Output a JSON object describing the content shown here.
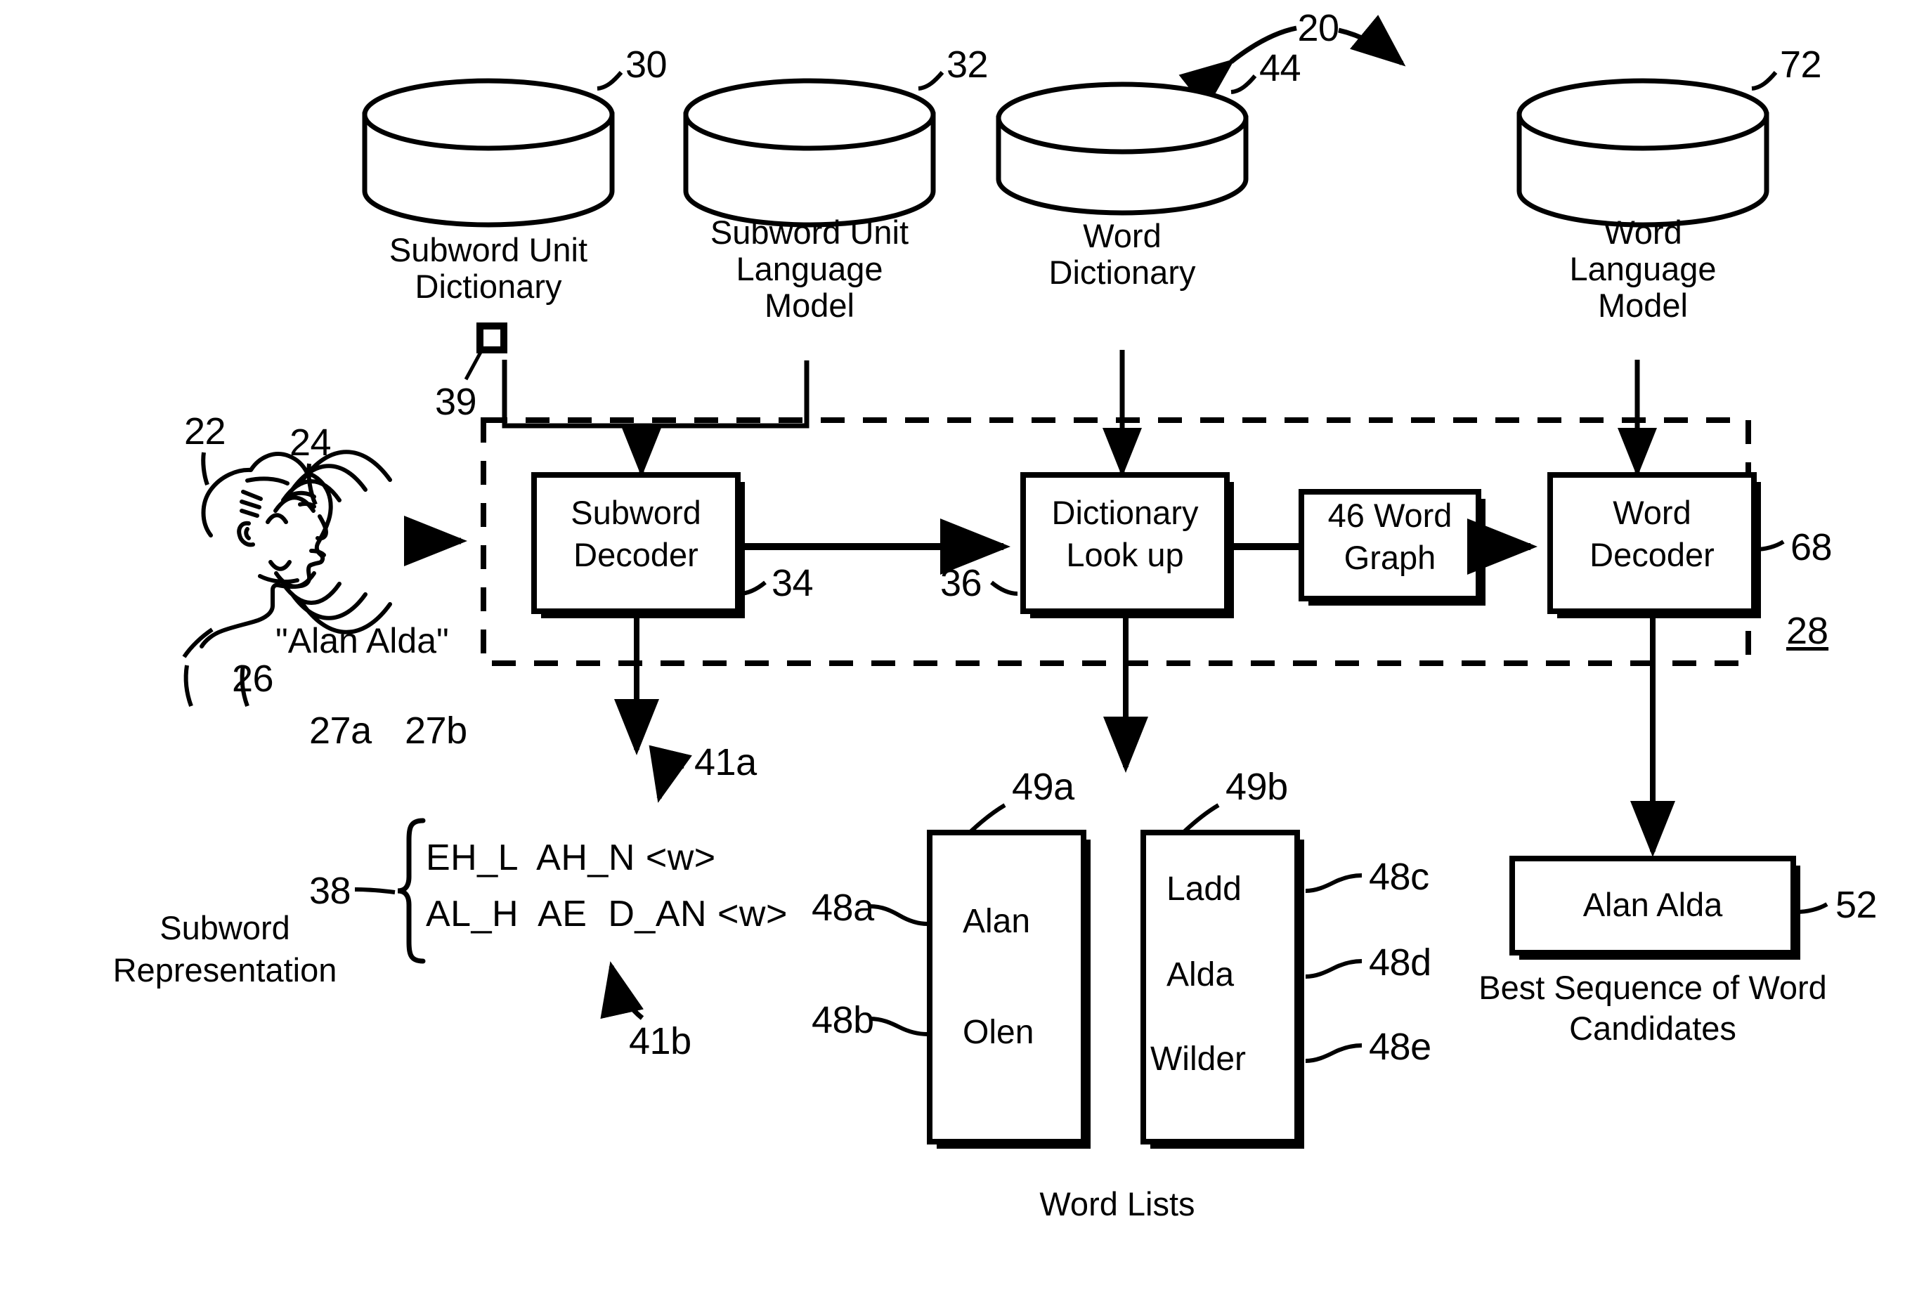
{
  "figure": {
    "overall_ref": "20",
    "system_ref": "28"
  },
  "datastores": [
    {
      "ref": "30",
      "lines": [
        "Subword Unit",
        "Dictionary"
      ],
      "marker_ref": "39"
    },
    {
      "ref": "32",
      "lines": [
        "Subword Unit",
        "Language",
        "Model"
      ]
    },
    {
      "ref": "44",
      "lines": [
        "Word",
        "Dictionary"
      ]
    },
    {
      "ref": "72",
      "lines": [
        "Word",
        "Language",
        "Model"
      ]
    }
  ],
  "speaker": {
    "head_ref": "22",
    "speech_wave_ref": "24",
    "utterance": "\"Alan Alda\"",
    "utterance_ref": "26",
    "word1_ref": "27a",
    "word2_ref": "27b"
  },
  "process_blocks": [
    {
      "ref": "34",
      "lines": [
        "Subword",
        "Decoder"
      ]
    },
    {
      "ref": "36",
      "lines": [
        "Dictionary",
        "Look up"
      ]
    },
    {
      "ref": "",
      "lines": [
        "46 Word",
        "Graph"
      ]
    },
    {
      "ref": "68",
      "lines": [
        "Word",
        "Decoder"
      ]
    }
  ],
  "subword_representation": {
    "ref": "38",
    "caption_lines": [
      "Subword",
      "Representation"
    ],
    "rows": [
      "EH_L  AH_N <w>",
      "AL_H  AE  D_AN <w>"
    ],
    "row1_ref": "41a",
    "row2_ref": "41b"
  },
  "word_lists": {
    "caption": "Word Lists",
    "lists": [
      {
        "ref": "49a",
        "items": [
          {
            "ref": "48a",
            "word": "Alan",
            "ref_side": "left"
          },
          {
            "ref": "48b",
            "word": "Olen",
            "ref_side": "left"
          }
        ]
      },
      {
        "ref": "49b",
        "items": [
          {
            "ref": "48c",
            "word": "Ladd",
            "ref_side": "right"
          },
          {
            "ref": "48d",
            "word": "Alda",
            "ref_side": "right"
          },
          {
            "ref": "48e",
            "word": "Wilder",
            "ref_side": "right"
          }
        ]
      }
    ]
  },
  "result": {
    "ref": "52",
    "text": "Alan Alda",
    "caption_lines": [
      "Best Sequence of Word",
      "Candidates"
    ]
  },
  "colors": {
    "ink": "#000000",
    "paper": "#ffffff"
  }
}
